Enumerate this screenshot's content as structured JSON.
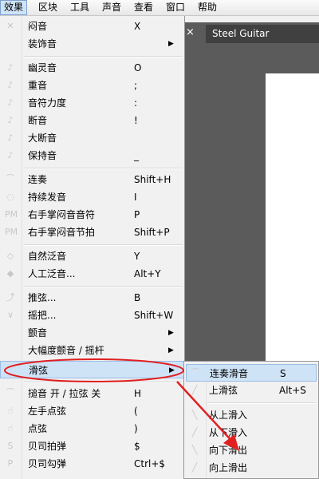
{
  "menubar": {
    "items": [
      {
        "label": "效果",
        "active": true
      },
      {
        "label": "区块"
      },
      {
        "label": "工具"
      },
      {
        "label": "声音"
      },
      {
        "label": "查看"
      },
      {
        "label": "窗口"
      },
      {
        "label": "帮助"
      }
    ]
  },
  "document": {
    "tab_close": "×",
    "tab_title": "Steel Guitar"
  },
  "effects_menu": {
    "items": [
      {
        "label": "闷音",
        "shortcut": "X",
        "icon": "mute-icon"
      },
      {
        "label": "装饰音",
        "shortcut": "",
        "icon": "none",
        "submenu": true
      },
      {
        "label": "幽灵音",
        "shortcut": "O",
        "icon": "ghost-note-icon"
      },
      {
        "label": "重音",
        "shortcut": ";",
        "icon": "accent-icon"
      },
      {
        "label": "音符力度",
        "shortcut": ":",
        "icon": "velocity-icon"
      },
      {
        "label": "断音",
        "shortcut": "!",
        "icon": "staccato-icon"
      },
      {
        "label": "大断音",
        "shortcut": "",
        "icon": "staccatissimo-icon"
      },
      {
        "label": "保持音",
        "shortcut": "_",
        "icon": "tenuto-icon"
      },
      {
        "label": "连奏",
        "shortcut": "Shift+H",
        "icon": "legato-icon"
      },
      {
        "label": "持续发音",
        "shortcut": "I",
        "icon": "let-ring-icon"
      },
      {
        "label": "右手掌闷音音符",
        "shortcut": "P",
        "icon": "palm-mute-icon"
      },
      {
        "label": "右手掌闷音节拍",
        "shortcut": "Shift+P",
        "icon": "palm-mute-beat-icon"
      },
      {
        "label": "自然泛音",
        "shortcut": "Y",
        "icon": "natural-harmonic-icon"
      },
      {
        "label": "人工泛音...",
        "shortcut": "Alt+Y",
        "icon": "artificial-harmonic-icon"
      },
      {
        "label": "推弦...",
        "shortcut": "B",
        "icon": "bend-icon"
      },
      {
        "label": "摇把...",
        "shortcut": "Shift+W",
        "icon": "whammy-bar-icon"
      },
      {
        "label": "颤音",
        "shortcut": "",
        "icon": "none",
        "submenu": true
      },
      {
        "label": "大幅度颤音 / 摇杆",
        "shortcut": "",
        "icon": "none",
        "submenu": true
      },
      {
        "label": "滑弦",
        "shortcut": "",
        "icon": "none",
        "submenu": true,
        "highlighted": true
      },
      {
        "label": "搥音 开 / 拉弦 关",
        "shortcut": "H",
        "icon": "hammer-on-icon"
      },
      {
        "label": "左手点弦",
        "shortcut": "(",
        "icon": "left-hand-tap-icon"
      },
      {
        "label": "点弦",
        "shortcut": ")",
        "icon": "tapping-icon"
      },
      {
        "label": "贝司拍弹",
        "shortcut": "$",
        "icon": "slap-icon"
      },
      {
        "label": "贝司勾弹",
        "shortcut": "Ctrl+$",
        "icon": "pop-icon"
      }
    ]
  },
  "slide_submenu": {
    "items": [
      {
        "label": "连奏滑音",
        "shortcut": "S",
        "icon": "legato-slide-icon",
        "highlighted": true
      },
      {
        "label": "上滑弦",
        "shortcut": "Alt+S",
        "icon": "shift-slide-icon"
      },
      {
        "label": "从上滑入",
        "shortcut": "",
        "icon": "slide-in-above-icon"
      },
      {
        "label": "从下滑入",
        "shortcut": "",
        "icon": "slide-in-below-icon"
      },
      {
        "label": "向下滑出",
        "shortcut": "",
        "icon": "slide-out-down-icon"
      },
      {
        "label": "向上滑出",
        "shortcut": "",
        "icon": "slide-out-up-icon"
      }
    ]
  },
  "colors": {
    "highlight": "#cfe3f7",
    "annotation": "#e02020",
    "workarea": "#5b5b5b"
  }
}
